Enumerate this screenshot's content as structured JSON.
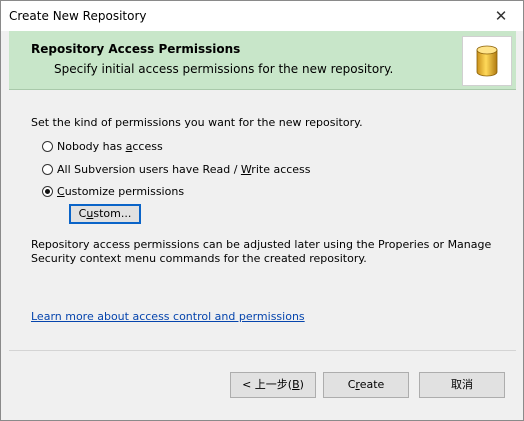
{
  "window": {
    "title": "Create New Repository",
    "close_glyph": "✕"
  },
  "header": {
    "title": "Repository Access Permissions",
    "subtitle": "Specify initial access permissions for the new repository.",
    "icon": "database-cylinder-icon"
  },
  "body": {
    "intro": "Set the kind of permissions you want for the new repository.",
    "options": [
      {
        "pre": "Nobody has ",
        "accel": "a",
        "post": "ccess",
        "checked": false
      },
      {
        "pre": "All Subversion users have Read / ",
        "accel": "W",
        "post": "rite access",
        "checked": false
      },
      {
        "pre": "",
        "accel": "C",
        "post": "ustomize permissions",
        "checked": true
      }
    ],
    "custom_button": {
      "pre": "C",
      "accel": "u",
      "post": "stom..."
    },
    "note": "Repository access permissions can be adjusted later using the Properies or Manage Security context menu commands for the created repository.",
    "link": "Learn more about access control and permissions"
  },
  "footer": {
    "back": {
      "pre": "< 上一步(",
      "accel": "B",
      "post": ")"
    },
    "create": {
      "pre": "C",
      "accel": "r",
      "post": "eate"
    },
    "cancel": "取消"
  },
  "colors": {
    "header_bg": "#c8e6c9",
    "link": "#0645ad",
    "focus_border": "#0a64c8",
    "icon_fill": "#f2c94c"
  }
}
